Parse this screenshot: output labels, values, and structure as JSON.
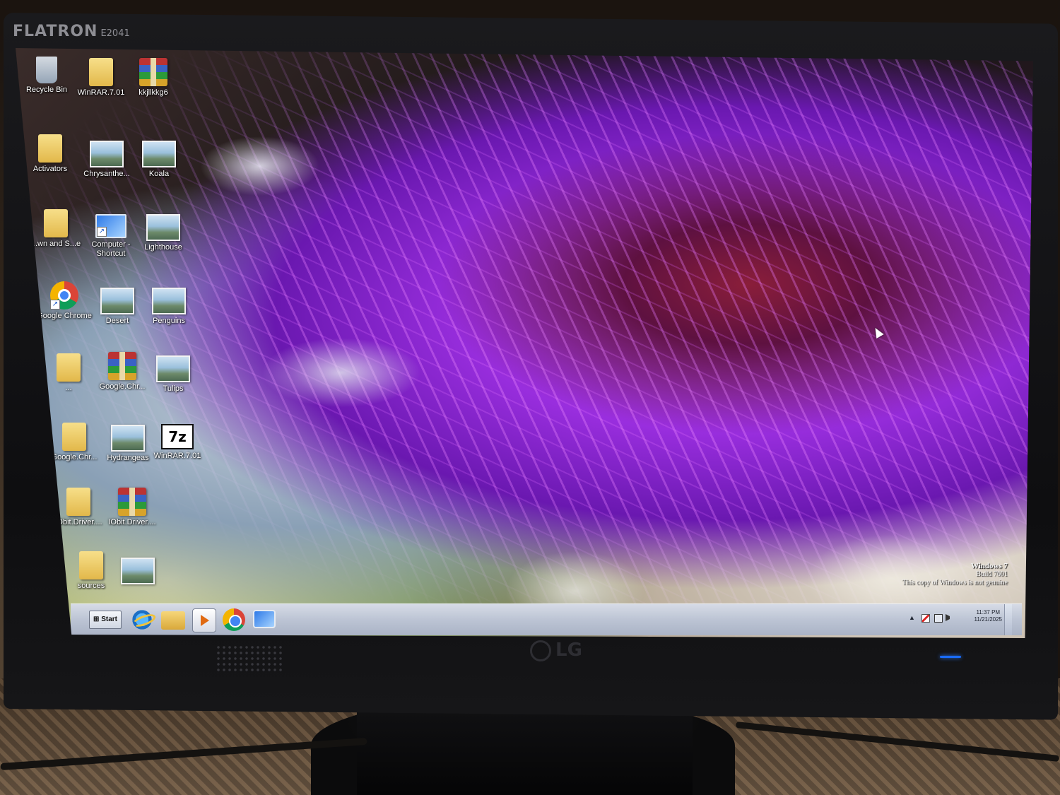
{
  "monitor": {
    "brand": "FLATRON",
    "model": "E2041",
    "logo": "LG"
  },
  "desktop": {
    "icons": [
      {
        "label": "Recycle Bin",
        "icon": "recycle-bin-icon"
      },
      {
        "label": "WinRAR.7.01",
        "icon": "folder-icon"
      },
      {
        "label": "kkjllkkg6",
        "icon": "winrar-archive-icon"
      },
      {
        "label": "Activators",
        "icon": "folder-icon"
      },
      {
        "label": "Chrysanthe...",
        "icon": "picture-icon"
      },
      {
        "label": "Koala",
        "icon": "picture-icon"
      },
      {
        "label": "...wn and S...e",
        "icon": "folder-icon"
      },
      {
        "label": "Computer - Shortcut",
        "icon": "computer-shortcut-icon"
      },
      {
        "label": "Lighthouse",
        "icon": "picture-icon"
      },
      {
        "label": "Google Chrome",
        "icon": "chrome-icon"
      },
      {
        "label": "Desert",
        "icon": "picture-icon"
      },
      {
        "label": "Penguins",
        "icon": "picture-icon"
      },
      {
        "label": "...",
        "icon": "folder-icon"
      },
      {
        "label": "Google.Chr...",
        "icon": "winrar-archive-icon"
      },
      {
        "label": "Tulips",
        "icon": "picture-icon"
      },
      {
        "label": "Google.Chr...",
        "icon": "folder-icon"
      },
      {
        "label": "Hydrangeas",
        "icon": "picture-icon"
      },
      {
        "label": "WinRAR.7.01",
        "icon": "seven-zip-icon"
      },
      {
        "label": "IObit.Driver....",
        "icon": "folder-icon"
      },
      {
        "label": "IObit.Driver....",
        "icon": "winrar-archive-icon"
      },
      {
        "label": "sources",
        "icon": "folder-icon"
      },
      {
        "label": "",
        "icon": "picture-icon"
      }
    ]
  },
  "watermark": {
    "title": "Windows 7",
    "build": "Build 7601",
    "notice": "This copy of Windows is not genuine"
  },
  "taskbar": {
    "start_label": "Start",
    "pinned": [
      "internet-explorer-icon",
      "windows-explorer-icon",
      "media-player-icon",
      "chrome-icon",
      "remote-desktop-icon"
    ],
    "clock_time": "11:37 PM",
    "clock_date": "11/21/2025"
  }
}
